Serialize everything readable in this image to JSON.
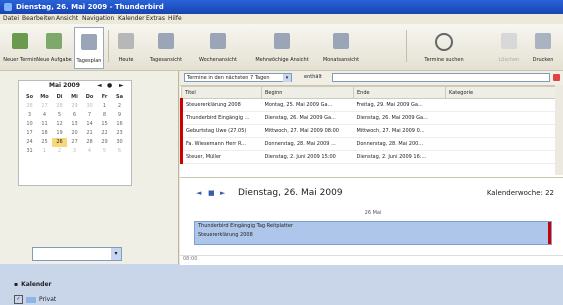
{
  "window": {
    "title": "Dienstag, 26. Mai 2009 - Thunderbird"
  },
  "menu": {
    "items": [
      "Datei",
      "Bearbeiten",
      "Ansicht",
      "Navigation",
      "Kalender",
      "Extras",
      "Hilfe"
    ]
  },
  "toolbar": {
    "buttons": [
      {
        "label": "Neuer Termin",
        "icon": "new-event-icon"
      },
      {
        "label": "Neue Aufgabe",
        "icon": "new-task-icon"
      },
      {
        "label": "Tagesplan",
        "icon": "day-view-icon",
        "active": true
      },
      {
        "label": "Heute",
        "icon": "today-icon"
      },
      {
        "label": "Tagesansicht",
        "icon": "day-icon"
      },
      {
        "label": "Wochenansicht",
        "icon": "week-icon"
      },
      {
        "label": "Mehrwöchige Ansicht",
        "icon": "multiweek-icon"
      },
      {
        "label": "Monatsansicht",
        "icon": "month-icon"
      },
      {
        "label": "Termine suchen",
        "icon": "search-icon"
      },
      {
        "label": "Löschen",
        "icon": "delete-icon"
      },
      {
        "label": "Drucken",
        "icon": "print-icon"
      }
    ]
  },
  "minicalendar": {
    "month": "Mai 2009",
    "prev": "◄",
    "today": "●",
    "next": "►",
    "weekdays": [
      "So",
      "Mo",
      "Di",
      "Mi",
      "Do",
      "Fr",
      "Sa"
    ],
    "weeks": [
      [
        "26",
        "27",
        "28",
        "29",
        "30",
        "1",
        "2"
      ],
      [
        "3",
        "4",
        "5",
        "6",
        "7",
        "8",
        "9"
      ],
      [
        "10",
        "11",
        "12",
        "13",
        "14",
        "15",
        "16"
      ],
      [
        "17",
        "18",
        "19",
        "20",
        "21",
        "22",
        "23"
      ],
      [
        "24",
        "25",
        "26",
        "27",
        "28",
        "29",
        "30"
      ],
      [
        "31",
        "1",
        "2",
        "3",
        "4",
        "5",
        "6"
      ]
    ]
  },
  "sidebar": {
    "combo_value": "",
    "section": "Kalender",
    "calendar_item": "Privat"
  },
  "filter": {
    "range": "Termine in den nächsten 7 Tagen",
    "label": "enthält",
    "query": ""
  },
  "table": {
    "headers": [
      "Titel",
      "Beginn",
      "Ende",
      "Kategorie"
    ],
    "rows": [
      [
        "Steuererklärung 2008",
        "Montag, 25. Mai 2009 Ga...",
        "Freitag, 29. Mai 2009 Ga...",
        ""
      ],
      [
        "Thunderbird Eingängig ...",
        "Dienstag, 26. Mai 2009 Ga...",
        "Dienstag, 26. Mai 2009 Ga...",
        ""
      ],
      [
        "Geburtstag Uwe (27.05)",
        "Mittwoch, 27. Mai 2009 08:00",
        "Mittwoch, 27. Mai 2009 0...",
        ""
      ],
      [
        "Fa. Wiesemann Herr R...",
        "Donnerstag, 28. Mai 2009 ...",
        "Donnerstag, 28. Mai 200...",
        ""
      ],
      [
        "Steuer, Müller",
        "Dienstag, 2. Juni 2009 15:00",
        "Dienstag, 2. Juni 2009 16:...",
        ""
      ]
    ]
  },
  "dayview": {
    "date": "Dienstag, 26. Mai 2009",
    "week": "Kalenderwoche: 22",
    "time_label": "26 Mai",
    "events": [
      "Thunderbird Eingängig Tag Reitplatter",
      "Steuererklärung 2008"
    ],
    "bottom_time": "08:00"
  },
  "colors": {
    "titlebar": "#1e4fc2",
    "event_fill": "#aec6ea",
    "accent_red": "#c00"
  }
}
